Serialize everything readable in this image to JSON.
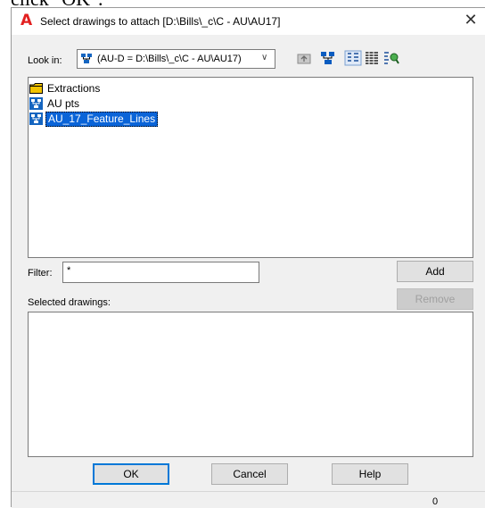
{
  "fragment": {
    "text": "click \"OK\"."
  },
  "window": {
    "title": "Select drawings to attach [D:\\Bills\\_c\\C - AU\\AU17]",
    "close_glyph": "✕"
  },
  "look_in": {
    "label": "Look in:",
    "value": "(AU-D = D:\\Bills\\_c\\C - AU\\AU17)",
    "arrow_glyph": "∨"
  },
  "toolbar": {
    "icons": [
      "up-folder-icon",
      "network-tree-icon",
      "list-view-icon",
      "details-view-icon",
      "preview-icon"
    ]
  },
  "file_list": {
    "items": [
      {
        "label": "Extractions",
        "icon": "folder-icon",
        "selected": false
      },
      {
        "label": "AU pts",
        "icon": "drawing-network-icon",
        "selected": false
      },
      {
        "label": "AU_17_Feature_Lines",
        "icon": "drawing-network-icon",
        "selected": true
      }
    ]
  },
  "filter": {
    "label": "Filter:",
    "value": "*"
  },
  "buttons": {
    "add": "Add",
    "remove": "Remove",
    "ok": "OK",
    "cancel": "Cancel",
    "help": "Help"
  },
  "selected": {
    "label": "Selected drawings:"
  },
  "status": {
    "count": "0"
  },
  "colors": {
    "accent": "#0078d7",
    "selection": "#0a64d8",
    "app_icon": "#e22020"
  }
}
